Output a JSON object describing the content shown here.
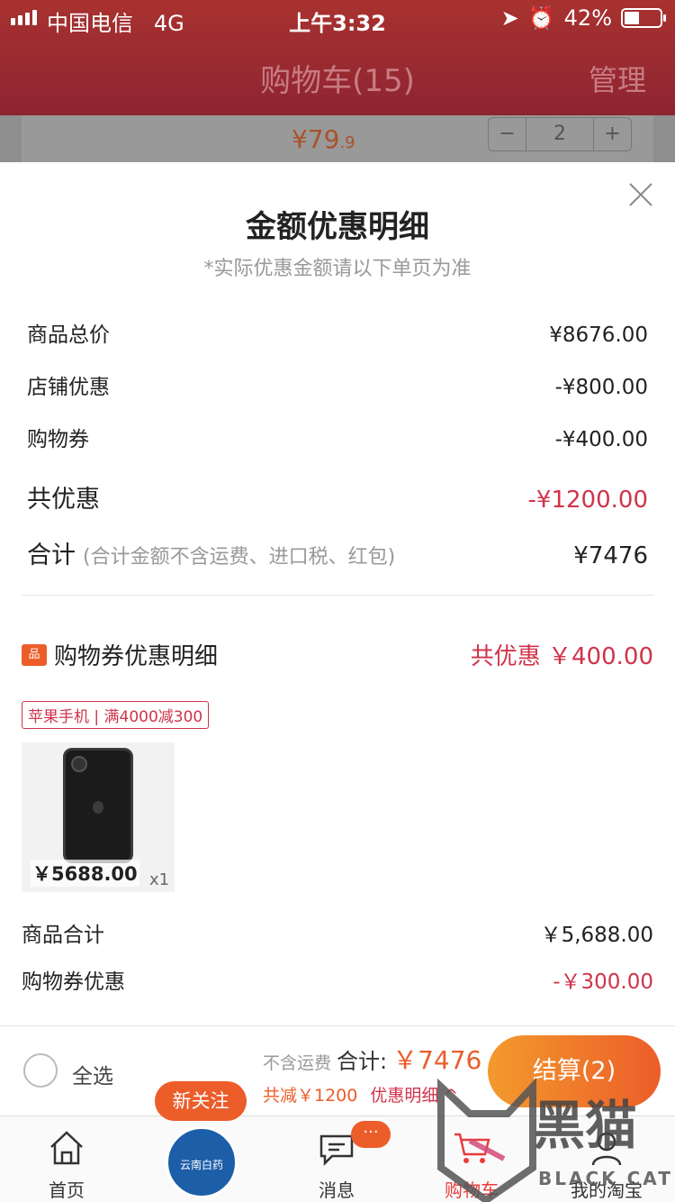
{
  "status": {
    "carrier": "中国电信",
    "network": "4G",
    "time": "上午3:32",
    "battery": "42%"
  },
  "header": {
    "title": "购物车(15)",
    "manage": "管理"
  },
  "behind_row": {
    "price": "¥79",
    "price_cents": ".9",
    "minus": "−",
    "qty": "2",
    "plus": "+"
  },
  "sheet": {
    "title": "金额优惠明细",
    "subtitle": "*实际优惠金额请以下单页为准",
    "rows": [
      {
        "label": "商品总价",
        "value": "¥8676.00"
      },
      {
        "label": "店铺优惠",
        "value": "-¥800.00"
      },
      {
        "label": "购物券",
        "value": "-¥400.00"
      }
    ],
    "total_discount": {
      "label": "共优惠",
      "value": "-¥1200.00"
    },
    "total": {
      "label": "合计",
      "note": "(合计金额不含运费、进口税、红包)",
      "value": "¥7476"
    },
    "coupon": {
      "icon_text": "品",
      "title": "购物券优惠明细",
      "discount": "共优惠 ￥400.00",
      "tag": "苹果手机 | 满4000减300"
    },
    "product": {
      "price": "￥5688.00",
      "qty": "x1"
    },
    "summary": [
      {
        "label": "商品合计",
        "value": "￥5,688.00"
      },
      {
        "label": "购物券优惠",
        "value": "-￥300.00"
      }
    ]
  },
  "bottom": {
    "select_all": "全选",
    "no_shipping": "不含运费",
    "total_label": "合计:",
    "total_value": "￥7476",
    "reduced": "共减￥1200",
    "detail": "优惠明细 ^",
    "checkout": "结算(2)"
  },
  "tabbar": {
    "new_follow": "新关注",
    "brand_text": "云南白药",
    "msg_badge": "···",
    "tabs": [
      {
        "label": "首页",
        "icon": "home-icon"
      },
      {
        "label": "消息",
        "icon": "message-icon"
      },
      {
        "label": "购物车",
        "icon": "cart-icon"
      },
      {
        "label": "我的淘宝",
        "icon": "profile-icon"
      }
    ]
  },
  "watermark": {
    "text": "黑猫",
    "sub": "BLACK CAT"
  },
  "colors": {
    "accent": "#ec5d2a",
    "discount_red": "#d0334a",
    "header_red": "#8e2432"
  }
}
